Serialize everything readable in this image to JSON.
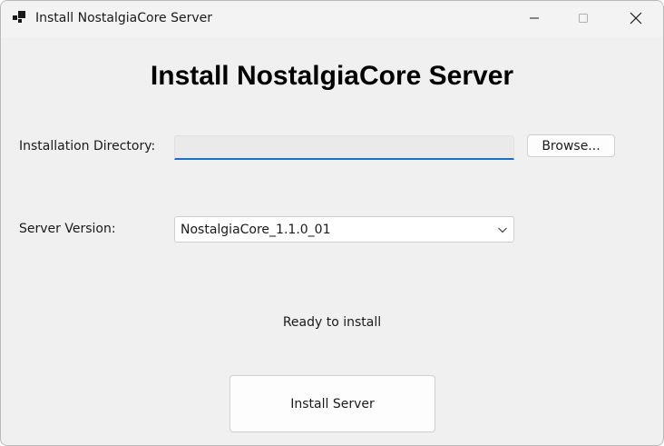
{
  "window": {
    "title": "Install NostalgiaCore Server",
    "icon": "app-window-icon",
    "controls": [
      "minimize-icon",
      "maximize-icon",
      "close-icon"
    ]
  },
  "main": {
    "heading": "Install NostalgiaCore Server",
    "install_dir": {
      "label": "Installation Directory:",
      "value": "",
      "placeholder": ""
    },
    "browse_label": "Browse...",
    "server_version": {
      "label": "Server Version:",
      "selected": "NostalgiaCore_1.1.0_01"
    },
    "status": "Ready to install",
    "install_label": "Install Server"
  },
  "colors": {
    "window_bg": "#f0f0f0",
    "titlebar_bg": "#f3f3f3",
    "input_underline": "#1f6fc0",
    "button_bg": "#fdfdfd",
    "border": "#d0d0d0"
  }
}
